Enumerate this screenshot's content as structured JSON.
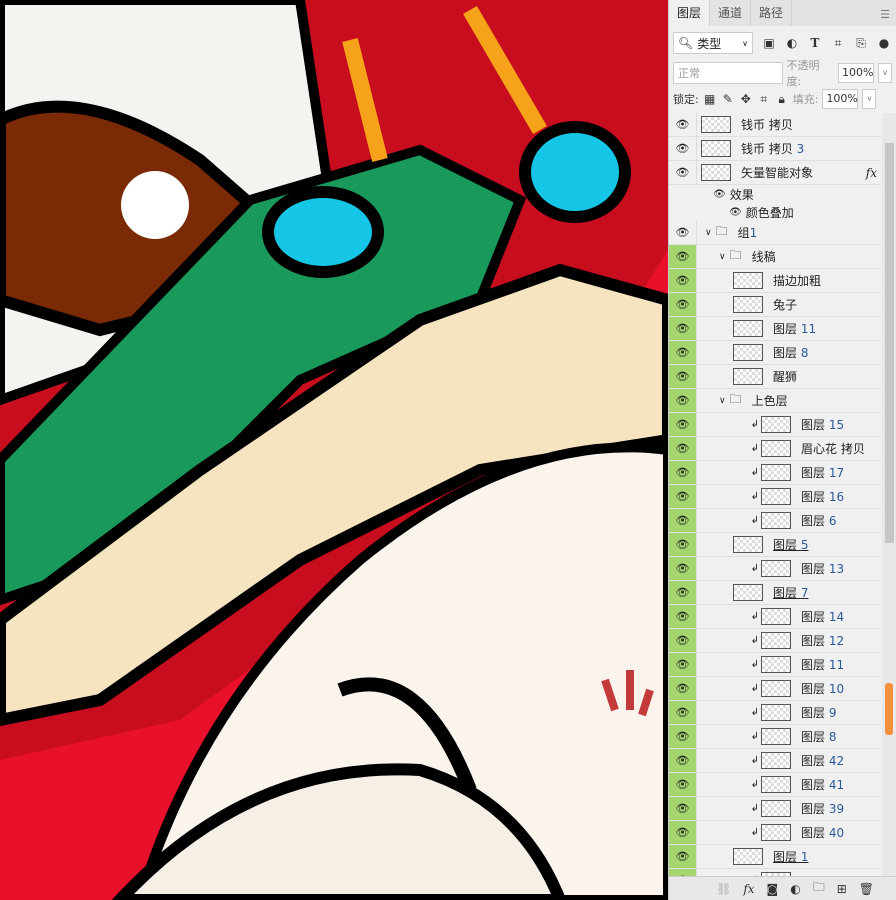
{
  "tabs": [
    {
      "label": "图层"
    },
    {
      "label": "通道"
    },
    {
      "label": "路径"
    }
  ],
  "filter": {
    "label": "类型"
  },
  "blend": {
    "mode": "正常",
    "opacity_label": "不透明度:",
    "opacity": "100%"
  },
  "lock": {
    "label": "锁定:",
    "fill_label": "填充:",
    "fill": "100%"
  },
  "layers": [
    {
      "name": "钱币 拷贝",
      "num": "",
      "indent": 0,
      "type": "layer",
      "green": false
    },
    {
      "name": "钱币 拷贝",
      "num": "3",
      "indent": 0,
      "type": "layer",
      "green": false
    },
    {
      "name": "矢量智能对象",
      "num": "",
      "indent": 0,
      "type": "smart",
      "green": false,
      "fx": "fx"
    },
    {
      "name": "效果",
      "type": "effects"
    },
    {
      "name": "颜色叠加",
      "type": "effect"
    },
    {
      "name": "组",
      "num": "1",
      "indent": 0,
      "type": "group",
      "green": false
    },
    {
      "name": "线稿",
      "num": "",
      "indent": 1,
      "type": "group",
      "green": true
    },
    {
      "name": "描边加粗",
      "num": "",
      "indent": 2,
      "type": "layer",
      "green": true
    },
    {
      "name": "兔子",
      "num": "",
      "indent": 2,
      "type": "layer",
      "green": true
    },
    {
      "name": "图层",
      "num": "11",
      "indent": 2,
      "type": "layer",
      "green": true
    },
    {
      "name": "图层",
      "num": "8",
      "indent": 2,
      "type": "layer",
      "green": true
    },
    {
      "name": "醒狮",
      "num": "",
      "indent": 2,
      "type": "layer",
      "green": true
    },
    {
      "name": "上色层",
      "num": "",
      "indent": 1,
      "type": "group",
      "green": true
    },
    {
      "name": "图层",
      "num": "15",
      "indent": 3,
      "type": "clip",
      "green": true
    },
    {
      "name": "眉心花 拷贝",
      "num": "",
      "indent": 3,
      "type": "clip",
      "green": true
    },
    {
      "name": "图层",
      "num": "17",
      "indent": 3,
      "type": "clip",
      "green": true
    },
    {
      "name": "图层",
      "num": "16",
      "indent": 3,
      "type": "clip",
      "green": true
    },
    {
      "name": "图层",
      "num": "6",
      "indent": 3,
      "type": "clip",
      "green": true
    },
    {
      "name": "图层",
      "num": "5",
      "indent": 2,
      "type": "base",
      "green": true
    },
    {
      "name": "图层",
      "num": "13",
      "indent": 3,
      "type": "clip",
      "green": true
    },
    {
      "name": "图层",
      "num": "7",
      "indent": 2,
      "type": "base",
      "green": true
    },
    {
      "name": "图层",
      "num": "14",
      "indent": 3,
      "type": "clip",
      "green": true
    },
    {
      "name": "图层",
      "num": "12",
      "indent": 3,
      "type": "clip",
      "green": true
    },
    {
      "name": "图层",
      "num": "11",
      "indent": 3,
      "type": "clip",
      "green": true
    },
    {
      "name": "图层",
      "num": "10",
      "indent": 3,
      "type": "clip",
      "green": true
    },
    {
      "name": "图层",
      "num": "9",
      "indent": 3,
      "type": "clip",
      "green": true
    },
    {
      "name": "图层",
      "num": "8",
      "indent": 3,
      "type": "clip",
      "green": true
    },
    {
      "name": "图层",
      "num": "42",
      "indent": 3,
      "type": "clip",
      "green": true
    },
    {
      "name": "图层",
      "num": "41",
      "indent": 3,
      "type": "clip",
      "green": true
    },
    {
      "name": "图层",
      "num": "39",
      "indent": 3,
      "type": "clip",
      "green": true
    },
    {
      "name": "图层",
      "num": "40",
      "indent": 3,
      "type": "clip",
      "green": true
    },
    {
      "name": "图层",
      "num": "1",
      "indent": 2,
      "type": "base",
      "green": true
    },
    {
      "name": "",
      "num": "",
      "indent": 3,
      "type": "clip",
      "green": true
    }
  ],
  "footer": {
    "icons": [
      "link-icon",
      "fx-icon",
      "mask-icon",
      "adjustment-icon",
      "folder-icon",
      "new-layer-icon",
      "trash-icon"
    ],
    "fx": "fx"
  },
  "colors": {
    "visible_green": "#a5d56f",
    "scroll_accent": "#f7903a"
  }
}
